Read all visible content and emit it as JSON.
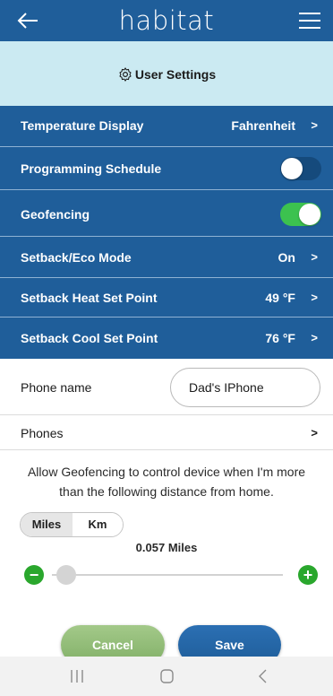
{
  "app": {
    "brand": "habitat"
  },
  "icons": {
    "back": "arrow-left-icon",
    "menu": "hamburger-menu-icon",
    "settings": "gear-icon",
    "chevron": "chevron-right-icon",
    "minus": "minus-circle-icon",
    "plus": "plus-circle-icon",
    "recents": "recents-icon",
    "home": "home-icon",
    "nav_back": "chevron-left-icon"
  },
  "header": {
    "title": "User Settings"
  },
  "settings": {
    "temperature_display": {
      "label": "Temperature Display",
      "value": "Fahrenheit",
      "chevron": ">"
    },
    "programming_schedule": {
      "label": "Programming Schedule",
      "enabled": false
    },
    "geofencing": {
      "label": "Geofencing",
      "enabled": true
    },
    "setback_eco": {
      "label": "Setback/Eco Mode",
      "value": "On",
      "chevron": ">"
    },
    "setback_heat": {
      "label": "Setback Heat Set Point",
      "value": "49 °F",
      "chevron": ">"
    },
    "setback_cool": {
      "label": "Setback Cool Set Point",
      "value": "76 °F",
      "chevron": ">"
    }
  },
  "phone_name": {
    "label": "Phone name",
    "value": "Dad's IPhone"
  },
  "phones": {
    "label": "Phones",
    "chevron": ">"
  },
  "geofence": {
    "description": "Allow Geofencing to control device when I'm more than the following distance from home.",
    "units": [
      "Miles",
      "Km"
    ],
    "selected_unit": "Miles",
    "distance_text": "0.057 Miles",
    "slider_fraction": 0.02,
    "minus": "−",
    "plus": "+"
  },
  "buttons": {
    "cancel": "Cancel",
    "save": "Save"
  },
  "colors": {
    "primary": "#1f5e9a",
    "header_band": "#cbeaf2",
    "toggle_on": "#3cc24f",
    "toggle_off": "#154a7c",
    "stepper": "#2aa72d",
    "cancel_button": "#8fbb74"
  }
}
